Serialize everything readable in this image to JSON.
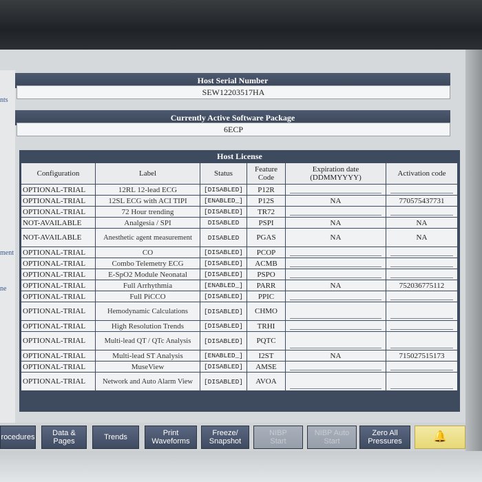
{
  "side_labels": [
    "nts",
    "ment",
    "ne"
  ],
  "host_serial": {
    "title": "Host Serial Number",
    "value": "SEW12203517HA"
  },
  "software_package": {
    "title": "Currently Active Software Package",
    "value": "6ECP"
  },
  "host_license": {
    "title": "Host License",
    "headers": [
      "Configuration",
      "Label",
      "Status",
      "Feature Code",
      "Expiration date (DDMMYYYY)",
      "Activation code"
    ],
    "rows": [
      {
        "config": "OPTIONAL-TRIAL",
        "label": "12RL 12-lead ECG",
        "status": "[DISABLED]",
        "code": "P12R",
        "expiration": "",
        "activation": ""
      },
      {
        "config": "OPTIONAL-TRIAL",
        "label": "12SL ECG with ACI TIPI",
        "status": "[ENABLED_]",
        "code": "P12S",
        "expiration": "NA",
        "activation": "770575437731"
      },
      {
        "config": "OPTIONAL-TRIAL",
        "label": "72 Hour trending",
        "status": "[DISABLED]",
        "code": "TR72",
        "expiration": "",
        "activation": ""
      },
      {
        "config": "NOT-AVAILABLE",
        "label": "Analgesia / SPI",
        "status": "DISABLED",
        "code": "PSPI",
        "expiration": "NA",
        "activation": "NA"
      },
      {
        "config": "NOT-AVAILABLE",
        "label": "Anesthetic agent measurement",
        "status": "DISABLED",
        "code": "PGAS",
        "expiration": "NA",
        "activation": "NA"
      },
      {
        "config": "OPTIONAL-TRIAL",
        "label": "CO",
        "status": "[DISABLED]",
        "code": "PCOP",
        "expiration": "",
        "activation": ""
      },
      {
        "config": "OPTIONAL-TRIAL",
        "label": "Combo Telemetry ECG",
        "status": "[DISABLED]",
        "code": "ACMB",
        "expiration": "",
        "activation": ""
      },
      {
        "config": "OPTIONAL-TRIAL",
        "label": "E-SpO2 Module Neonatal",
        "status": "[DISABLED]",
        "code": "PSPO",
        "expiration": "",
        "activation": ""
      },
      {
        "config": "OPTIONAL-TRIAL",
        "label": "Full Arrhythmia",
        "status": "[ENABLED_]",
        "code": "PARR",
        "expiration": "NA",
        "activation": "752036775112"
      },
      {
        "config": "OPTIONAL-TRIAL",
        "label": "Full PiCCO",
        "status": "[DISABLED]",
        "code": "PPIC",
        "expiration": "",
        "activation": ""
      },
      {
        "config": "OPTIONAL-TRIAL",
        "label": "Hemodynamic Calculations",
        "status": "[DISABLED]",
        "code": "CHMO",
        "expiration": "",
        "activation": ""
      },
      {
        "config": "OPTIONAL-TRIAL",
        "label": "High Resolution Trends",
        "status": "[DISABLED]",
        "code": "TRHI",
        "expiration": "",
        "activation": ""
      },
      {
        "config": "OPTIONAL-TRIAL",
        "label": "Multi-lead QT / QTc Analysis",
        "status": "[DISABLED]",
        "code": "PQTC",
        "expiration": "",
        "activation": ""
      },
      {
        "config": "OPTIONAL-TRIAL",
        "label": "Multi-lead ST Analysis",
        "status": "[ENABLED_]",
        "code": "I2ST",
        "expiration": "NA",
        "activation": "715027515173"
      },
      {
        "config": "OPTIONAL-TRIAL",
        "label": "MuseView",
        "status": "[DISABLED]",
        "code": "AMSE",
        "expiration": "",
        "activation": ""
      },
      {
        "config": "OPTIONAL-TRIAL",
        "label": "Network and Auto Alarm View",
        "status": "[DISABLED]",
        "code": "AVOA",
        "expiration": "",
        "activation": ""
      }
    ]
  },
  "toolbar": {
    "procedures": "rocedures",
    "data_pages_1": "Data &",
    "data_pages_2": "Pages",
    "trends": "Trends",
    "print_1": "Print",
    "print_2": "Waveforms",
    "freeze_1": "Freeze/",
    "freeze_2": "Snapshot",
    "nibp_start_1": "NIBP",
    "nibp_start_2": "Start",
    "nibp_auto_1": "NIBP Auto",
    "nibp_auto_2": "Start",
    "zero_all_1": "Zero All",
    "zero_all_2": "Pressures",
    "alarm_icon": "bell-icon"
  }
}
